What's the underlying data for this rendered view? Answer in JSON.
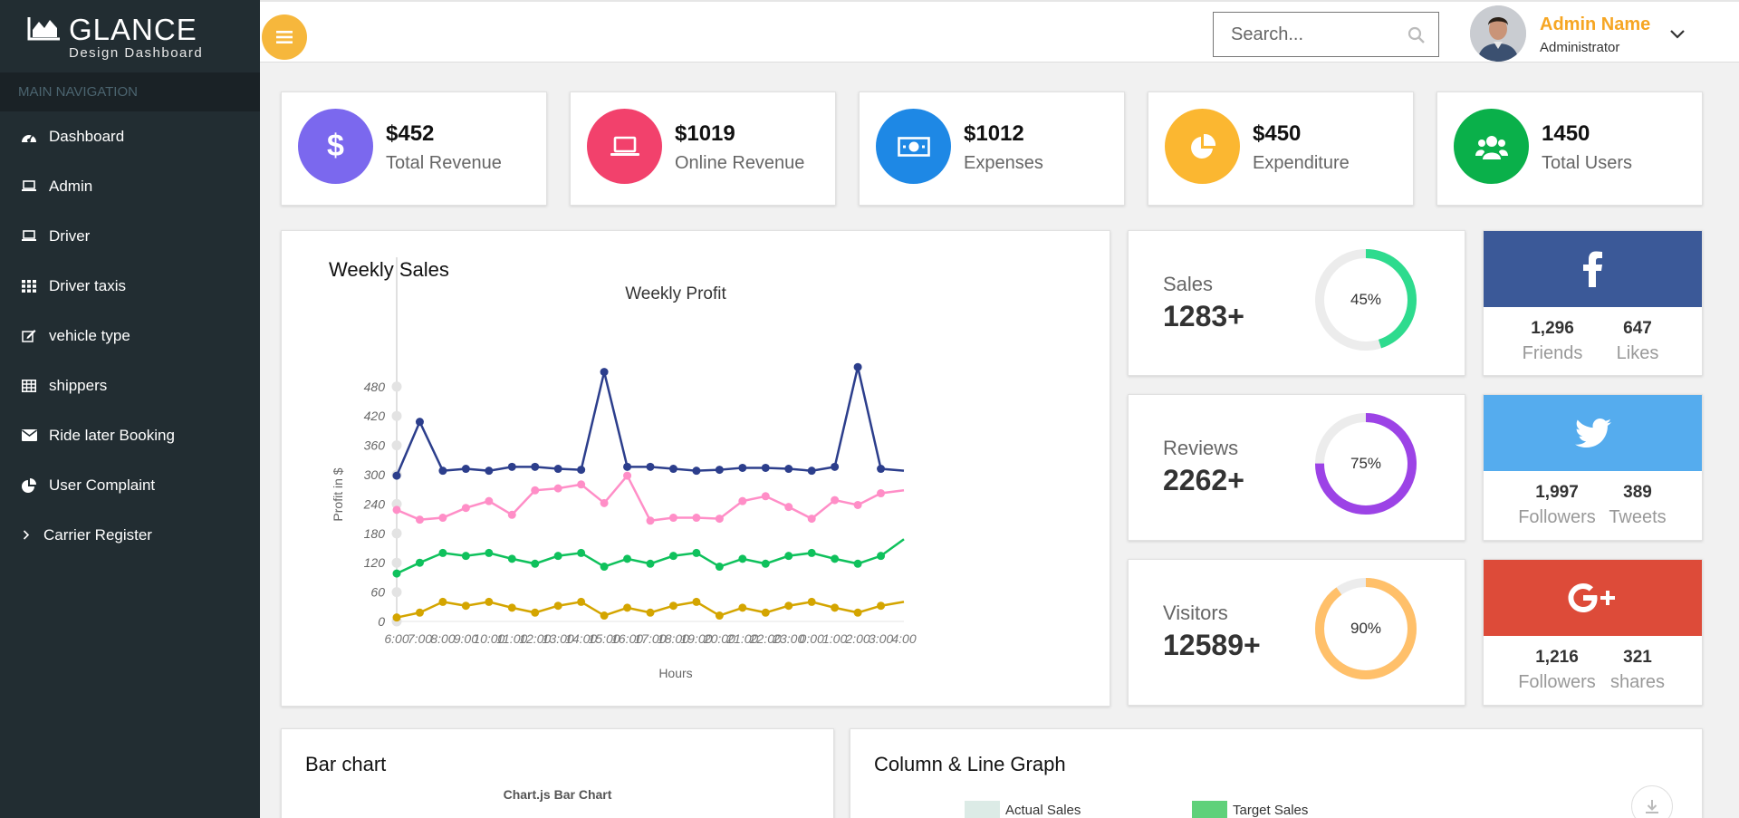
{
  "brand": {
    "title": "GLANCE",
    "subtitle": "Design Dashboard"
  },
  "nav": {
    "header": "MAIN NAVIGATION",
    "items": [
      {
        "label": "Dashboard",
        "icon": "dashboard-gauge-icon"
      },
      {
        "label": "Admin",
        "icon": "laptop-icon"
      },
      {
        "label": "Driver",
        "icon": "laptop-icon"
      },
      {
        "label": "Driver taxis",
        "icon": "grid-icon"
      },
      {
        "label": "vehicle type",
        "icon": "edit-icon"
      },
      {
        "label": "shippers",
        "icon": "table-icon"
      },
      {
        "label": "Ride later Booking",
        "icon": "envelope-icon"
      },
      {
        "label": "User Complaint",
        "icon": "pie-chart-icon"
      },
      {
        "label": "Carrier Register",
        "icon": "chevron-right-icon"
      }
    ]
  },
  "search": {
    "placeholder": "Search..."
  },
  "user": {
    "name": "Admin Name",
    "role": "Administrator"
  },
  "stats": [
    {
      "value": "$452",
      "label": "Total Revenue",
      "color": "#7b68ee",
      "icon": "dollar-icon"
    },
    {
      "value": "$1019",
      "label": "Online Revenue",
      "color": "#f2416c",
      "icon": "laptop-icon"
    },
    {
      "value": "$1012",
      "label": "Expenses",
      "color": "#1e88e5",
      "icon": "money-icon"
    },
    {
      "value": "$450",
      "label": "Expenditure",
      "color": "#fbb731",
      "icon": "pie-chart-icon"
    },
    {
      "value": "1450",
      "label": "Total Users",
      "color": "#0ab04a",
      "icon": "users-icon"
    }
  ],
  "weekly": {
    "title": "Weekly Sales"
  },
  "chart_data": {
    "type": "line",
    "title": "Weekly Profit",
    "xlabel": "Hours",
    "ylabel": "Profit in $",
    "ylim": [
      0,
      500
    ],
    "yticks": [
      0,
      60,
      120,
      180,
      240,
      300,
      360,
      420,
      480
    ],
    "x": [
      "6:00",
      "7:00",
      "8:00",
      "9:00",
      "10:00",
      "11:00",
      "12:00",
      "13:00",
      "14:00",
      "15:00",
      "16:00",
      "17:00",
      "18:00",
      "19:00",
      "20:00",
      "21:00",
      "22:00",
      "23:00",
      "0:00",
      "1:00",
      "2:00",
      "3:00",
      "4:00"
    ],
    "xtick_labels": [
      "6:00",
      "7:00",
      "8:00",
      "9:00",
      "10:00",
      "11:00",
      "12:00",
      "13:00",
      "14:00",
      "15:00",
      "16:00",
      "17:00",
      "18:00",
      "19:00",
      "20:00",
      "21:00",
      "22:00",
      "23:00",
      "0:00",
      "1:00",
      "2:00",
      "3:00",
      "4:00"
    ],
    "series": [
      {
        "color": "#2c3e8c",
        "values": [
          298,
          408,
          308,
          312,
          308,
          316,
          316,
          312,
          310,
          510,
          316,
          316,
          312,
          308,
          310,
          314,
          314,
          312,
          308,
          316,
          520,
          312,
          308
        ]
      },
      {
        "color": "#ff8ec7",
        "values": [
          228,
          208,
          212,
          232,
          246,
          218,
          268,
          272,
          280,
          242,
          298,
          206,
          212,
          212,
          210,
          246,
          256,
          234,
          210,
          248,
          238,
          262,
          268
        ]
      },
      {
        "color": "#0fc15c",
        "values": [
          98,
          120,
          140,
          134,
          140,
          128,
          118,
          134,
          140,
          112,
          128,
          118,
          134,
          140,
          112,
          128,
          118,
          134,
          140,
          128,
          118,
          134,
          168
        ]
      },
      {
        "color": "#d4a500",
        "values": [
          8,
          18,
          40,
          32,
          40,
          28,
          18,
          32,
          40,
          12,
          28,
          18,
          32,
          40,
          12,
          28,
          18,
          32,
          40,
          28,
          18,
          32,
          40
        ]
      }
    ]
  },
  "kpis": [
    {
      "label": "Sales",
      "value": "1283+",
      "percent": 45,
      "pct_label": "45%",
      "color": "#2edb8e"
    },
    {
      "label": "Reviews",
      "value": "2262+",
      "percent": 75,
      "pct_label": "75%",
      "color": "#9c43e6"
    },
    {
      "label": "Visitors",
      "value": "12589+",
      "percent": 90,
      "pct_label": "90%",
      "color": "#ffc06a"
    }
  ],
  "social": [
    {
      "network": "facebook",
      "color": "#3b5998",
      "icon": "facebook-icon",
      "a_num": "1,296",
      "a_label": "Friends",
      "b_num": "647",
      "b_label": "Likes"
    },
    {
      "network": "twitter",
      "color": "#55acee",
      "icon": "twitter-icon",
      "a_num": "1,997",
      "a_label": "Followers",
      "b_num": "389",
      "b_label": "Tweets"
    },
    {
      "network": "google-plus",
      "color": "#dd4b39",
      "icon": "google-plus-icon",
      "a_num": "1,216",
      "a_label": "Followers",
      "b_num": "321",
      "b_label": "shares"
    }
  ],
  "bar": {
    "title": "Bar chart",
    "chart_title": "Chart.js Bar Chart"
  },
  "combo": {
    "title": "Column & Line Graph",
    "legend": [
      {
        "label": "Actual Sales",
        "color": "#dcebe6"
      },
      {
        "label": "Target Sales",
        "color": "#5fd17a"
      }
    ]
  }
}
